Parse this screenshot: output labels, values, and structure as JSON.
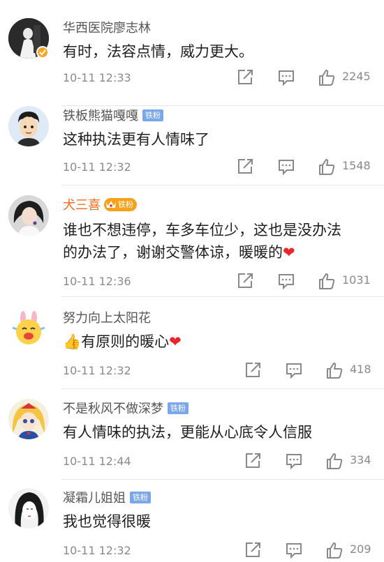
{
  "comments": [
    {
      "name": "华西医院廖志林",
      "text": "有时，法容点情，威力更大。",
      "time": "10-11 12:33",
      "likes": "2245"
    },
    {
      "name": "铁板熊猫嘎嘎",
      "badge": "铁粉",
      "text": "这种执法更有人情味了",
      "time": "10-11 12:32",
      "likes": "1548"
    },
    {
      "name": "犬三喜",
      "badge": "铁粉",
      "text_line1": "谁也不想违停，车多车位少，这也是没办法",
      "text_line2": "的办法了，谢谢交警体谅，暖暖的",
      "heart": "❤",
      "time": "10-11 12:36",
      "likes": "1031"
    },
    {
      "name": "努力向上太阳花",
      "thumb": "👍",
      "text": "有原则的暖心",
      "heart": "❤",
      "time": "10-11 12:32",
      "likes": "418"
    },
    {
      "name": "不是秋风不做深梦",
      "badge": "铁粉",
      "text": "有人情味的执法，更能从心底令人信服",
      "time": "10-11 12:44",
      "likes": "334"
    },
    {
      "name": "凝霜儿姐姐",
      "badge": "铁粉",
      "text": "我也觉得很暖",
      "time": "10-11 12:32",
      "likes": "209"
    }
  ],
  "icons": {
    "share": "share-icon",
    "reply": "reply-icon",
    "like": "like-thumb-icon",
    "verified": "verified-badge-icon",
    "crown": "crown-icon"
  },
  "colors": {
    "vip_name": "#f26b1d",
    "fan_badge": "#7aa7e9",
    "crown_badge": "#f5a21a",
    "heart": "#e8272d",
    "meta": "#8a8a8a"
  }
}
